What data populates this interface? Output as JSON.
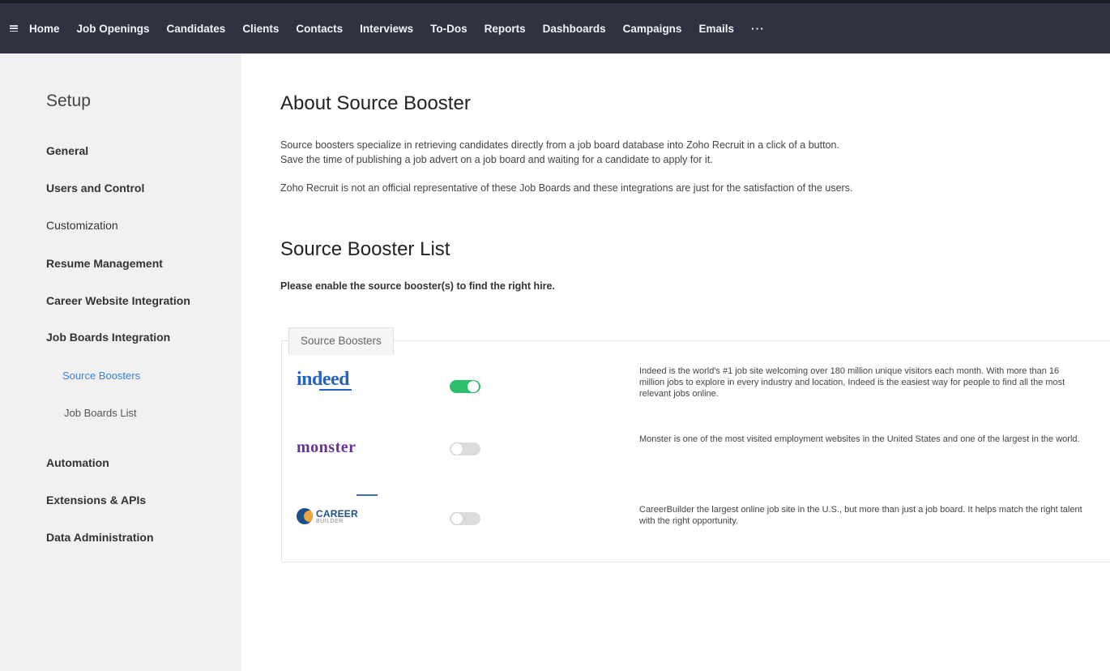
{
  "nav": {
    "items": [
      "Home",
      "Job Openings",
      "Candidates",
      "Clients",
      "Contacts",
      "Interviews",
      "To-Dos",
      "Reports",
      "Dashboards",
      "Campaigns",
      "Emails"
    ],
    "more": "···"
  },
  "sidebar": {
    "title": "Setup",
    "items": [
      {
        "label": "General"
      },
      {
        "label": "Users and Control"
      },
      {
        "label": "Customization"
      },
      {
        "label": "Resume Management"
      },
      {
        "label": "Career Website Integration"
      },
      {
        "label": "Job Boards Integration"
      },
      {
        "label": "Source Boosters"
      },
      {
        "label": "Job Boards List"
      },
      {
        "label": "Automation"
      },
      {
        "label": "Extensions & APIs"
      },
      {
        "label": "Data Administration"
      }
    ]
  },
  "main": {
    "about_title": "About Source Booster",
    "about_p1_line1": "Source boosters specialize in retrieving candidates directly from a job board database into Zoho Recruit in a click of a button.",
    "about_p1_line2": "Save the time of publishing a job advert on a job board and waiting for a candidate to apply for it.",
    "about_p2": "Zoho Recruit is not an official representative of these Job Boards and these integrations are just for the satisfaction of the users.",
    "list_title": "Source Booster List",
    "list_hint": "Please enable the source booster(s) to find the right hire.",
    "panel_tab": "Source Boosters",
    "boosters": [
      {
        "logo_text": "indeed",
        "enabled": true,
        "description": "Indeed is the world's #1 job site welcoming over 180 million unique visitors each month. With more than 16 million jobs to explore in every industry and location, Indeed is the easiest way for people to find all the most relevant jobs online."
      },
      {
        "logo_text": "monster",
        "enabled": false,
        "description": "Monster is one of the most visited employment websites in the United States and one of the largest in the world."
      },
      {
        "logo_text_main": "CAREER",
        "logo_text_sub": "BUILDER",
        "enabled": false,
        "description": "CareerBuilder the largest online job site in the U.S., but more than just a job board. It helps match the right talent with the right opportunity."
      }
    ]
  },
  "colors": {
    "topbar": "#2f3241",
    "sidebar": "#f1f1f1",
    "accent_link": "#3f7fd6",
    "toggle_on": "#2bbf6b",
    "toggle_off": "#dcdcdc"
  }
}
